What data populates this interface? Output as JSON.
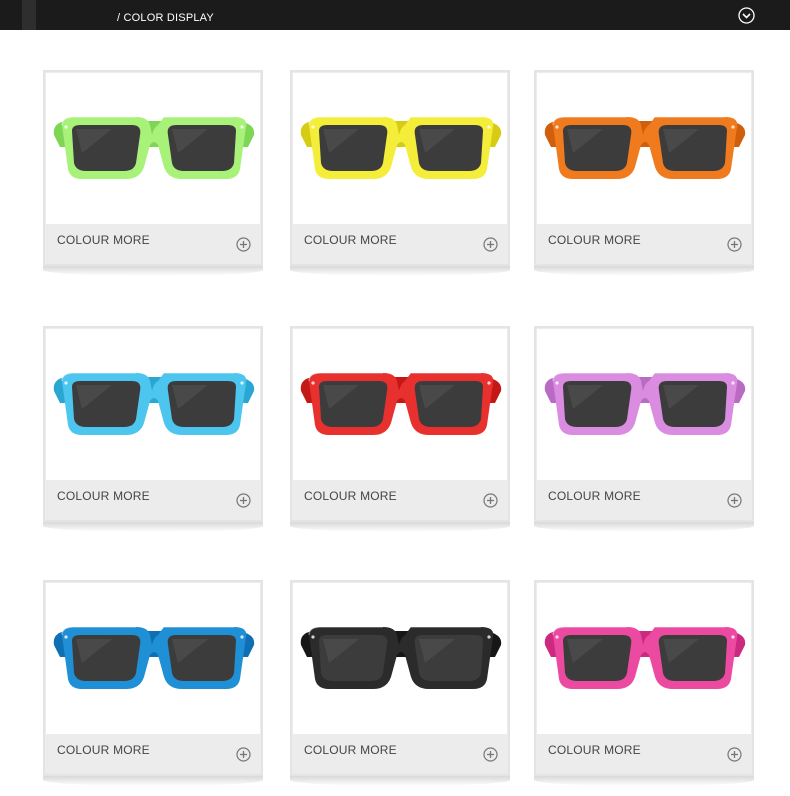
{
  "header": {
    "title": "/ COLOR DISPLAY",
    "expand_icon": "chevron-down-circle-icon"
  },
  "products": [
    {
      "caption": "COLOUR MORE",
      "frame_color": "#a8f27a",
      "frame_shade": "#7fd655",
      "action_icon": "plus-circle-icon"
    },
    {
      "caption": "COLOUR MORE",
      "frame_color": "#f4ee3a",
      "frame_shade": "#d6cc14",
      "action_icon": "plus-circle-icon"
    },
    {
      "caption": "COLOUR MORE",
      "frame_color": "#f07a1e",
      "frame_shade": "#cf5f0c",
      "action_icon": "plus-circle-icon"
    },
    {
      "caption": "COLOUR MORE",
      "frame_color": "#4cc6ee",
      "frame_shade": "#2aa6d2",
      "action_icon": "plus-circle-icon"
    },
    {
      "caption": "COLOUR MORE",
      "frame_color": "#e8312e",
      "frame_shade": "#c41816",
      "action_icon": "plus-circle-icon"
    },
    {
      "caption": "COLOUR MORE",
      "frame_color": "#d98ce0",
      "frame_shade": "#b96ac2",
      "action_icon": "plus-circle-icon"
    },
    {
      "caption": "COLOUR MORE",
      "frame_color": "#1f8fd6",
      "frame_shade": "#0f6fb3",
      "action_icon": "plus-circle-icon"
    },
    {
      "caption": "COLOUR MORE",
      "frame_color": "#2b2b2b",
      "frame_shade": "#161616",
      "action_icon": "plus-circle-icon"
    },
    {
      "caption": "COLOUR MORE",
      "frame_color": "#ec4aa0",
      "frame_shade": "#cc2a80",
      "action_icon": "plus-circle-icon"
    }
  ]
}
